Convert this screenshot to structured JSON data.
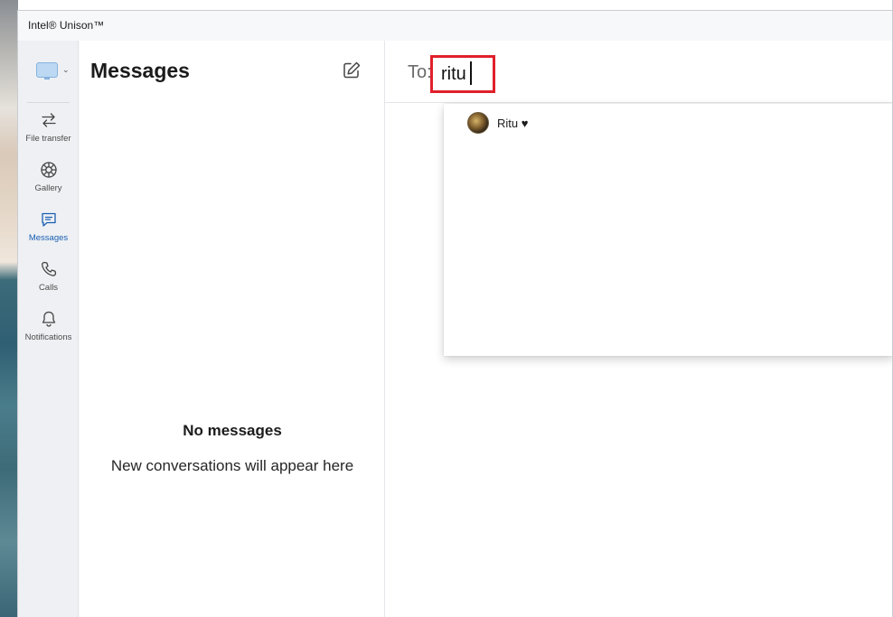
{
  "window": {
    "title": "Intel® Unison™"
  },
  "nav": {
    "items": [
      {
        "label": "File transfer",
        "icon": "file-transfer-icon"
      },
      {
        "label": "Gallery",
        "icon": "gallery-icon"
      },
      {
        "label": "Messages",
        "icon": "messages-icon",
        "active": true
      },
      {
        "label": "Calls",
        "icon": "phone-icon"
      },
      {
        "label": "Notifications",
        "icon": "bell-icon"
      }
    ]
  },
  "messages": {
    "title": "Messages",
    "empty_title": "No messages",
    "empty_subtitle": "New conversations will appear here"
  },
  "compose": {
    "to_label": "To:",
    "to_value": "ritu"
  },
  "suggestions": [
    {
      "name": "Ritu ♥",
      "icon": "contact-avatar"
    }
  ],
  "colors": {
    "accent": "#1a5fb4",
    "highlight_box": "#e0202b"
  }
}
